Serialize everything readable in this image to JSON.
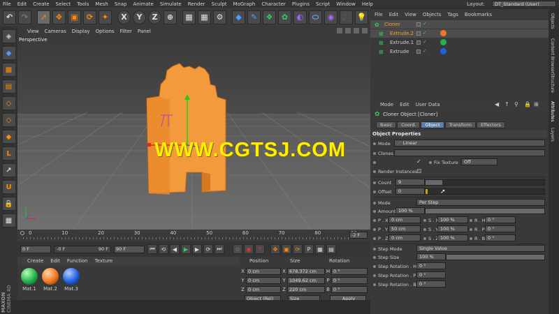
{
  "menu": [
    "File",
    "Edit",
    "Create",
    "Select",
    "Tools",
    "Mesh",
    "Snap",
    "Animate",
    "Simulate",
    "Render",
    "Sculpt",
    "MoGraph",
    "Character",
    "Plugins",
    "Script",
    "Window",
    "Help"
  ],
  "layout_label": "Layout:",
  "layout_value": "DT_Standard (User)",
  "toolbar": {
    "x_label": "X",
    "y_label": "Y",
    "z_label": "Z"
  },
  "viewport": {
    "menu": [
      "View",
      "Cameras",
      "Display",
      "Options",
      "Filter",
      "Panel"
    ],
    "label": "Perspective"
  },
  "watermark": "WWW.CGTSJ.COM",
  "timeline": {
    "ticks": [
      "0",
      "10",
      "20",
      "30",
      "40",
      "50",
      "60",
      "70",
      "80",
      "90"
    ],
    "frame_field": "-2 F"
  },
  "transport": {
    "start": "0 F",
    "current": "-0 F",
    "end": "90 F",
    "end2": "90 F"
  },
  "materials": {
    "menu": [
      "Create",
      "Edit",
      "Function",
      "Texture"
    ],
    "items": [
      {
        "name": "Mat.1",
        "color": "#22b14c"
      },
      {
        "name": "Mat.2",
        "color": "#f07820"
      },
      {
        "name": "Mat.3",
        "color": "#2060e0"
      }
    ]
  },
  "coords": {
    "head": [
      "Position",
      "Size",
      "Rotation"
    ],
    "rows": [
      {
        "a": "X",
        "pos": "0 cm",
        "sa": "X",
        "size": "678.372 cm",
        "ra": "H",
        "rot": "0 °"
      },
      {
        "a": "Y",
        "pos": "0 cm",
        "sa": "Y",
        "size": "1049.62 cm",
        "ra": "P",
        "rot": "0 °"
      },
      {
        "a": "Z",
        "pos": "0 cm",
        "sa": "Z",
        "size": "220 cm",
        "ra": "B",
        "rot": "0 °"
      }
    ],
    "mode": "Object (Rel)",
    "size_mode": "Size",
    "apply": "Apply"
  },
  "objects": {
    "menu": [
      "File",
      "Edit",
      "View",
      "Objects",
      "Tags",
      "Bookmarks"
    ],
    "items": [
      {
        "name": "Cloner",
        "color": "#f0a030",
        "selected": true,
        "indent": 0
      },
      {
        "name": "Extrude.2",
        "color": "#f0a030",
        "selected": true,
        "indent": 1
      },
      {
        "name": "Extrude.1",
        "color": "#cfcfcf",
        "selected": false,
        "indent": 1
      },
      {
        "name": "Extrude",
        "color": "#cfcfcf",
        "selected": false,
        "indent": 1
      }
    ]
  },
  "attributes": {
    "menu": [
      "Mode",
      "Edit",
      "User Data"
    ],
    "title": "Cloner Object [Cloner]",
    "tabs": [
      "Basic",
      "Coord.",
      "Object",
      "Transform",
      "Effectors"
    ],
    "active_tab": "Object",
    "section": "Object Properties",
    "mode_label": "Mode",
    "mode_value": "Linear",
    "clone_label": "Clones",
    "fix_texture_label": "Fix Texture",
    "fix_texture_value": "Off",
    "render_instances": "Render Instances",
    "count_label": "Count",
    "count_value": "9",
    "offset_label": "Offset",
    "offset_value": "0",
    "mode2_label": "Mode",
    "mode2_value": "Per Step",
    "amount_label": "Amount",
    "amount_value": "100 %",
    "amount_fill": 1.0,
    "count_fill": 0.14,
    "offset_fill": 0.02,
    "transform": [
      {
        "pl": "P . X",
        "pv": "0 cm",
        "sl": "S . X",
        "sv": "100 %",
        "rl": "R . H",
        "rv": "0 °"
      },
      {
        "pl": "P . Y",
        "pv": "50 cm",
        "sl": "S . Y",
        "sv": "100 %",
        "rl": "R . P",
        "rv": "0 °"
      },
      {
        "pl": "P . Z",
        "pv": "0 cm",
        "sl": "S . Z",
        "sv": "100 %",
        "rl": "R . B",
        "rv": "0 °"
      }
    ],
    "step_mode_label": "Step Mode",
    "step_mode_value": "Single Value",
    "step_size_label": "Step Size",
    "step_size_value": "100 %",
    "step_rot": [
      {
        "label": "Step Rotation . H",
        "value": "0 °"
      },
      {
        "label": "Step Rotation . P",
        "value": "0 °"
      },
      {
        "label": "Step Rotation . B",
        "value": "0 °"
      }
    ]
  },
  "sidetabs": [
    "Objects",
    "Content Browser",
    "Structure",
    "Attributes",
    "Layers"
  ],
  "brand": {
    "top": "MAXON",
    "bottom": "CINEMA 4D"
  }
}
